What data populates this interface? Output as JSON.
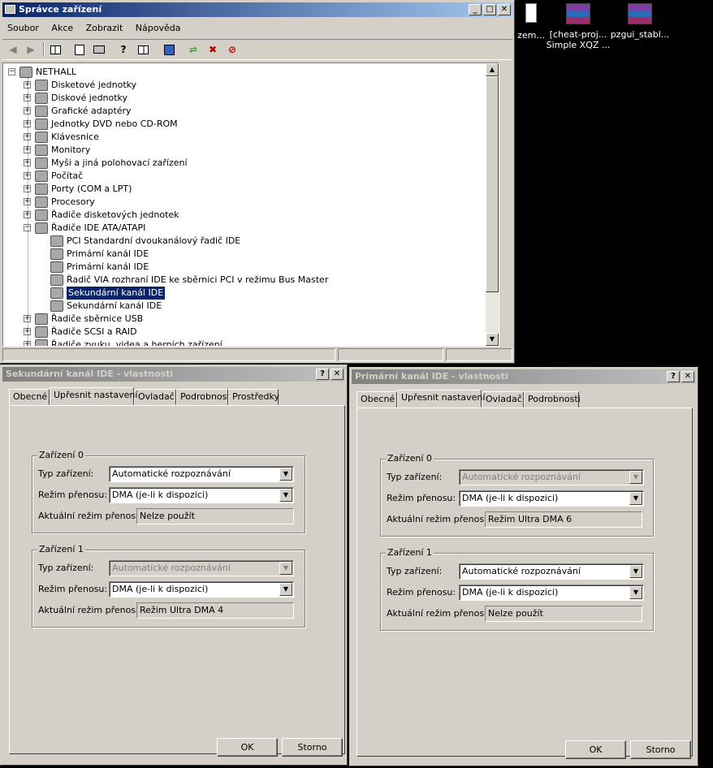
{
  "desktop": {
    "icons": [
      {
        "name": "desktop-icon-zem",
        "line1": "zem...",
        "line2": ""
      },
      {
        "name": "desktop-icon-cheat",
        "line1": "[cheat-proj...",
        "line2": "Simple XQZ ..."
      },
      {
        "name": "desktop-icon-pzgui",
        "line1": "pzgui_stabl...",
        "line2": ""
      }
    ]
  },
  "device_manager": {
    "title": "Správce zařízení",
    "menu": [
      "Soubor",
      "Akce",
      "Zobrazit",
      "Nápověda"
    ],
    "tree": {
      "root": "NETHALL",
      "items": [
        {
          "label": "Disketové jednotky",
          "icon": "floppy-icon",
          "expanded": false
        },
        {
          "label": "Diskové jednotky",
          "icon": "disk-icon",
          "expanded": false
        },
        {
          "label": "Grafické adaptéry",
          "icon": "monitor-icon",
          "expanded": false
        },
        {
          "label": "Jednotky DVD nebo CD-ROM",
          "icon": "cdrom-icon",
          "expanded": false
        },
        {
          "label": "Klávesnice",
          "icon": "keyboard-icon",
          "expanded": false
        },
        {
          "label": "Monitory",
          "icon": "monitor-icon",
          "expanded": false
        },
        {
          "label": "Myši a jiná polohovací zařízení",
          "icon": "mouse-icon",
          "expanded": false
        },
        {
          "label": "Počítač",
          "icon": "computer-icon",
          "expanded": false
        },
        {
          "label": "Porty (COM a LPT)",
          "icon": "port-icon",
          "expanded": false
        },
        {
          "label": "Procesory",
          "icon": "cpu-icon",
          "expanded": false
        },
        {
          "label": "Řadiče disketových jednotek",
          "icon": "controller-icon",
          "expanded": false
        },
        {
          "label": "Řadiče IDE ATA/ATAPI",
          "icon": "controller-icon",
          "expanded": true
        }
      ],
      "ide_children": [
        "PCI Standardní dvoukanálový řadič IDE",
        "Primární kanál IDE",
        "Primární kanál IDE",
        "Řadič VIA rozhraní IDE ke sběrnici PCI v režimu Bus Master",
        "Sekundární kanál IDE",
        "Sekundární kanál IDE"
      ],
      "selected_child_index": 4,
      "after_items": [
        {
          "label": "Řadiče sběrnice USB",
          "icon": "usb-icon"
        },
        {
          "label": "Řadiče SCSI a RAID",
          "icon": "scsi-icon"
        },
        {
          "label": "Řadiče zvuku, videa a herních zařízení",
          "icon": "sound-icon"
        }
      ]
    }
  },
  "dialog_secondary": {
    "title": "Sekundární kanál IDE - vlastnosti",
    "tabs": [
      "Obecné",
      "Upřesnit nastavení",
      "Ovladač",
      "Podrobnosti",
      "Prostředky"
    ],
    "active_tab": "Upřesnit nastavení",
    "groups": [
      {
        "title": "Zařízení 0",
        "device_type_label": "Typ zařízení:",
        "device_type_value": "Automatické rozpoznávání",
        "device_type_disabled": false,
        "mode_label": "Režim přenosu:",
        "mode_value": "DMA (je-li k dispozici)",
        "current_label": "Aktuální režim přenosu:",
        "current_value": "Nelze použít"
      },
      {
        "title": "Zařízení 1",
        "device_type_label": "Typ zařízení:",
        "device_type_value": "Automatické rozpoznávání",
        "device_type_disabled": true,
        "mode_label": "Režim přenosu:",
        "mode_value": "DMA (je-li k dispozici)",
        "current_label": "Aktuální režim přenosu:",
        "current_value": "Režim Ultra DMA 4"
      }
    ],
    "ok": "OK",
    "cancel": "Storno"
  },
  "dialog_primary": {
    "title": "Primární kanál IDE - vlastnosti",
    "tabs": [
      "Obecné",
      "Upřesnit nastavení",
      "Ovladač",
      "Podrobnosti"
    ],
    "active_tab": "Upřesnit nastavení",
    "groups": [
      {
        "title": "Zařízení 0",
        "device_type_label": "Typ zařízení:",
        "device_type_value": "Automatické rozpoznávání",
        "device_type_disabled": true,
        "mode_label": "Režim přenosu:",
        "mode_value": "DMA (je-li k dispozici)",
        "current_label": "Aktuální režim přenosu:",
        "current_value": "Režim Ultra DMA 6"
      },
      {
        "title": "Zařízení 1",
        "device_type_label": "Typ zařízení:",
        "device_type_value": "Automatické rozpoznávání",
        "device_type_disabled": false,
        "mode_label": "Režim přenosu:",
        "mode_value": "DMA (je-li k dispozici)",
        "current_label": "Aktuální režim přenosu:",
        "current_value": "Nelze použít"
      }
    ],
    "ok": "OK",
    "cancel": "Storno"
  },
  "colors": {
    "active_title": "#0a246a",
    "inactive_title": "#808080",
    "face": "#d4d0c8",
    "desktop": "#000000"
  }
}
